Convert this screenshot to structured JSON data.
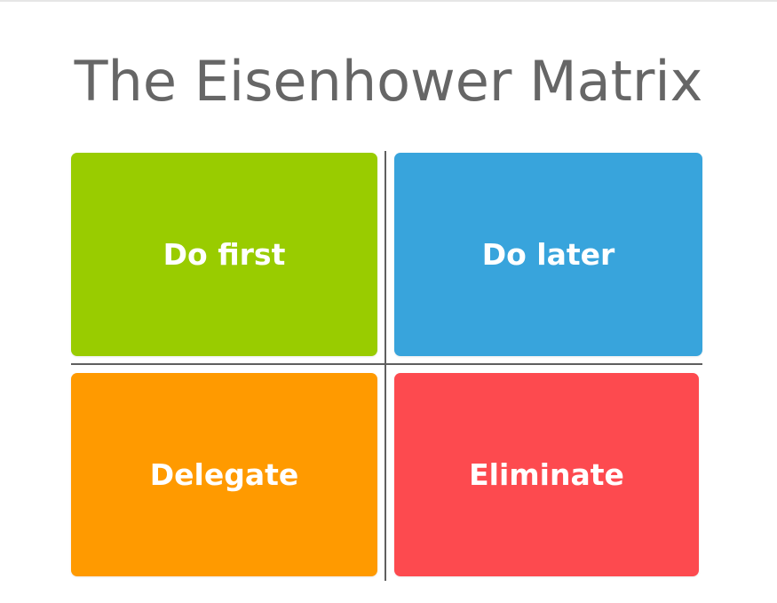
{
  "title": "The Eisenhower Matrix",
  "quadrants": [
    {
      "label": "Do first",
      "color": "#99cc00"
    },
    {
      "label": "Do later",
      "color": "#38a4dc"
    },
    {
      "label": "Delegate",
      "color": "#ff9a00"
    },
    {
      "label": "Eliminate",
      "color": "#fd4a4f"
    }
  ],
  "colors": {
    "title": "#666666",
    "divider": "#5f5f5f",
    "label": "#ffffff"
  }
}
